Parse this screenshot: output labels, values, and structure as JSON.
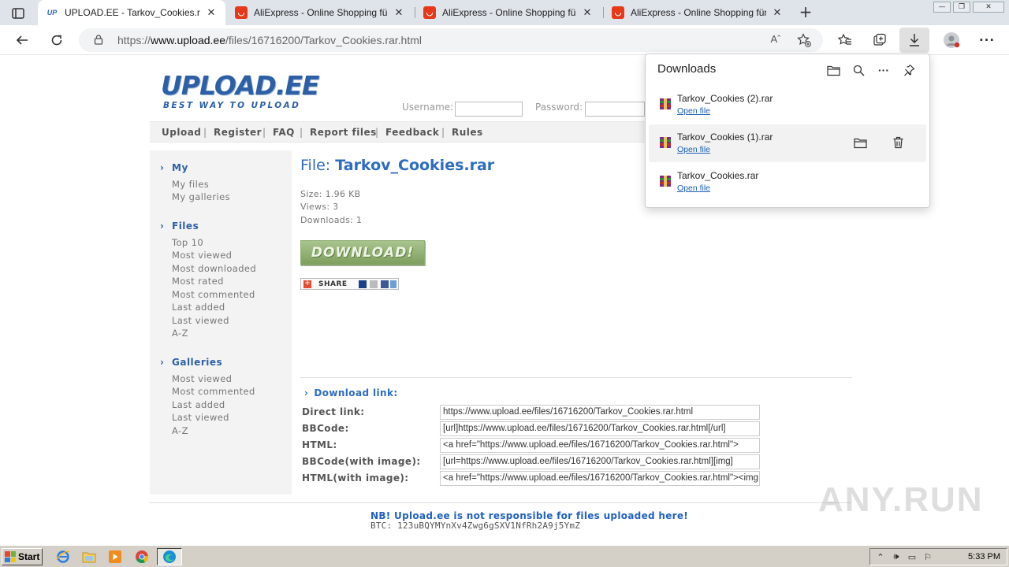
{
  "browser": {
    "tabs": [
      {
        "title": "UPLOAD.EE - Tarkov_Cookies.rar",
        "favicon": "up-icon",
        "active": true
      },
      {
        "title": "AliExpress - Online Shopping für",
        "favicon": "aliexpress-icon",
        "active": false
      },
      {
        "title": "AliExpress - Online Shopping für",
        "favicon": "aliexpress-icon",
        "active": false
      },
      {
        "title": "AliExpress - Online Shopping für",
        "favicon": "aliexpress-icon",
        "active": false
      }
    ],
    "address": {
      "prefix": "https://",
      "domain": "www.upload.ee",
      "path": "/files/16716200/Tarkov_Cookies.rar.html"
    },
    "reader_label": "Aˆ"
  },
  "site": {
    "logo_main": "UPLOAD.EE",
    "logo_tagline": "BEST WAY TO UPLOAD",
    "login": {
      "username_label": "Username:",
      "password_label": "Password:"
    },
    "menu": [
      "Upload",
      "Register",
      "FAQ",
      "Report files",
      "Feedback",
      "Rules"
    ],
    "menu_separator": "|",
    "sidebar": {
      "my": {
        "heading": "My",
        "items": [
          "My files",
          "My galleries"
        ]
      },
      "files": {
        "heading": "Files",
        "items": [
          "Top 10",
          "Most viewed",
          "Most downloaded",
          "Most rated",
          "Most commented",
          "Last added",
          "Last viewed",
          "A-Z"
        ]
      },
      "galleries": {
        "heading": "Galleries",
        "items": [
          "Most viewed",
          "Most commented",
          "Last added",
          "Last viewed",
          "A-Z"
        ]
      }
    },
    "file": {
      "title_prefix": "File: ",
      "name": "Tarkov_Cookies.rar",
      "size": "Size: 1.96 KB",
      "views": "Views: 3",
      "downloads": "Downloads: 1"
    },
    "download_button": "DOWNLOAD!",
    "share_label": "SHARE",
    "download_link_heading": "Download link:",
    "links": [
      {
        "label": "Direct link:",
        "value": "https://www.upload.ee/files/16716200/Tarkov_Cookies.rar.html"
      },
      {
        "label": "BBCode:",
        "value": "[url]https://www.upload.ee/files/16716200/Tarkov_Cookies.rar.html[/url]"
      },
      {
        "label": "HTML:",
        "value": "<a href=\"https://www.upload.ee/files/16716200/Tarkov_Cookies.rar.html\">"
      },
      {
        "label": "BBCode(with image):",
        "value": "[url=https://www.upload.ee/files/16716200/Tarkov_Cookies.rar.html][img]"
      },
      {
        "label": "HTML(with image):",
        "value": "<a href=\"https://www.upload.ee/files/16716200/Tarkov_Cookies.rar.html\"><img"
      }
    ],
    "notice": "NB! Upload.ee is not responsible for files uploaded here!",
    "btc": "BTC: 123uBQYMYnXv4Zwg6gSXV1NfRh2A9j5YmZ"
  },
  "downloads_panel": {
    "title": "Downloads",
    "items": [
      {
        "name": "Tarkov_Cookies (2).rar",
        "action": "Open file"
      },
      {
        "name": "Tarkov_Cookies (1).rar",
        "action": "Open file"
      },
      {
        "name": "Tarkov_Cookies.rar",
        "action": "Open file"
      }
    ]
  },
  "watermark": "ANY.RUN",
  "taskbar": {
    "start_label": "Start",
    "clock": "5:33 PM"
  },
  "colors": {
    "brand_blue": "#2d5fa6",
    "link_blue": "#2d6cc0",
    "download_green": "#7e9f5e",
    "aliexpress_red": "#e6391a"
  }
}
